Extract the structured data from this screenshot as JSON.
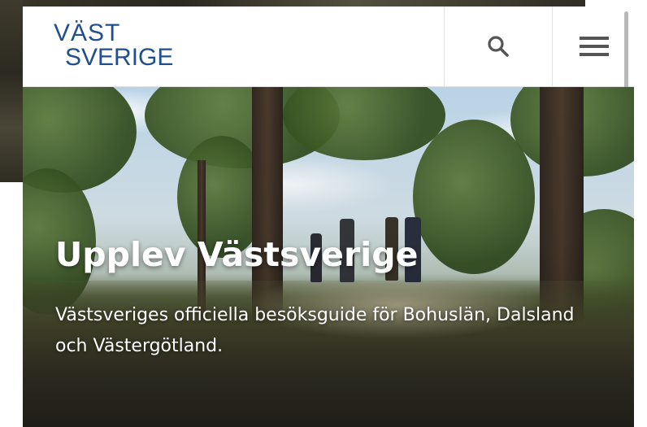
{
  "logo": {
    "line1": "VÄST",
    "line2": "SVERIGE",
    "accent": "˄˄",
    "brand_color": "#1f4f8c",
    "accent_color": "#f2b705"
  },
  "header": {
    "search_icon": "search-icon",
    "menu_icon": "hamburger-menu-icon"
  },
  "hero": {
    "title": "Upplev Västsverige",
    "text": "Västsveriges officiella besöksguide för Bohuslän, Dalsland och Västergötland."
  }
}
